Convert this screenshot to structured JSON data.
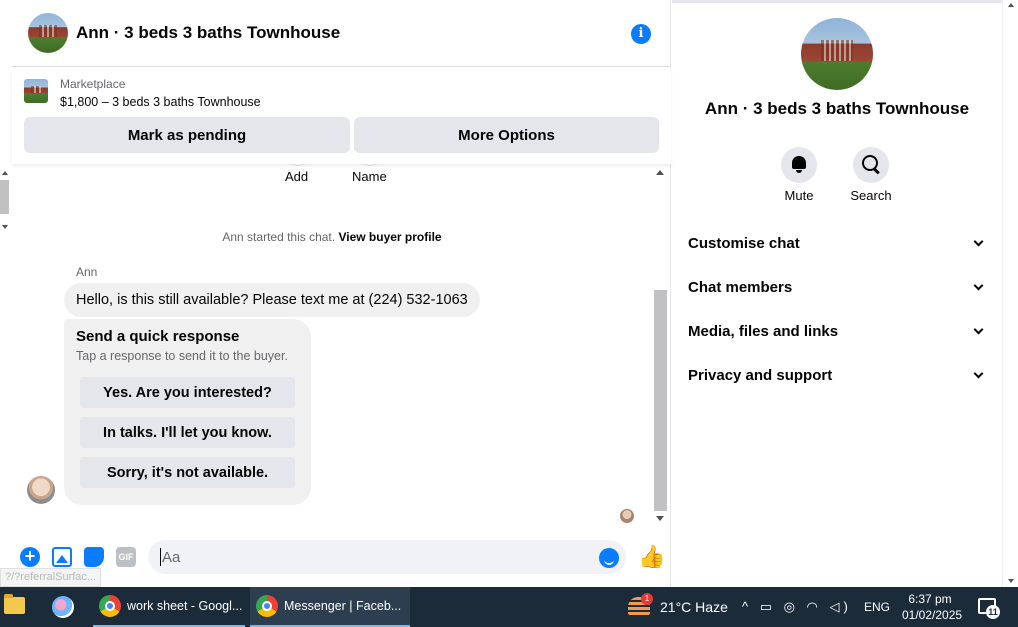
{
  "chat": {
    "title": "Ann · 3 beds 3 baths Townhouse",
    "marketplace": {
      "label": "Marketplace",
      "listing": "$1,800 – 3 beds 3 baths Townhouse",
      "pending_label": "Mark as pending",
      "more_label": "More Options"
    },
    "top_actions": {
      "add": "Add",
      "name": "Name"
    },
    "started_text": "Ann started this chat.",
    "view_profile": "View buyer profile",
    "sender": "Ann",
    "message": "Hello, is this still available? Please text me at (224) 532-1063",
    "quick_response": {
      "title": "Send a quick response",
      "subtitle": "Tap a response to send it to the buyer.",
      "options": [
        "Yes. Are you interested?",
        "In talks. I'll let you know.",
        "Sorry, it's not available."
      ]
    },
    "composer": {
      "placeholder": "Aa",
      "gif": "GIF"
    }
  },
  "status_url": "?/?referralSurfac...",
  "panel": {
    "title": "Ann · 3 beds 3 baths Townhouse",
    "actions": {
      "mute": "Mute",
      "search": "Search"
    },
    "sections": [
      "Customise chat",
      "Chat members",
      "Media, files and links",
      "Privacy and support"
    ]
  },
  "taskbar": {
    "tasks": [
      "work sheet - Googl...",
      "Messenger | Faceb..."
    ],
    "weather_badge": "1",
    "weather": "21°C  Haze",
    "tray_icons": [
      "chevron-up-icon",
      "battery-icon",
      "network-icon",
      "wifi-icon",
      "volume-icon"
    ],
    "tray_glyphs": "^ ▭ ◎ ◠ ◁)",
    "language": "ENG",
    "time": "6:37 pm",
    "date": "01/02/2025",
    "notification_count": "11"
  },
  "colors": {
    "accent": "#0a7cff",
    "bubble": "#f0f0f0",
    "button": "#e4e6eb",
    "taskbar": "#1c2b3a"
  }
}
